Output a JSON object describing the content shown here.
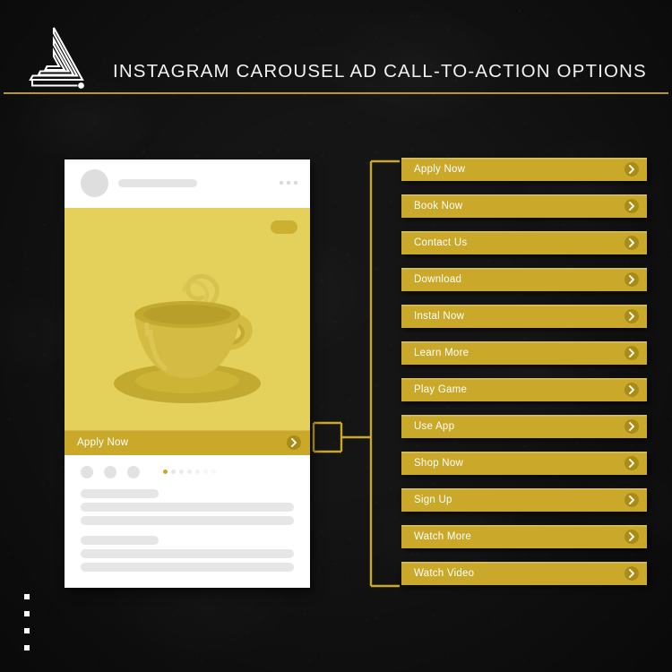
{
  "header": {
    "title": "INSTAGRAM CAROUSEL AD CALL-TO-ACTION OPTIONS",
    "logo_icon": "nested-triangle-logo-icon",
    "divider_color": "#b9991f"
  },
  "colors": {
    "gold": "#c9a82a",
    "gold_dark": "#a98c18",
    "gold_line": "#c9a82a",
    "post_yellow": "#e3d15c",
    "background": "#151515",
    "card_white": "#ffffff",
    "placeholder_gray": "#e6e6e6"
  },
  "mockup": {
    "name": "instagram-post-card",
    "header": {
      "avatar_icon": "avatar-placeholder-icon",
      "username_placeholder": "",
      "more_options_icon": "more-options-icon"
    },
    "image": {
      "subject": "coffee-cup-illustration",
      "sponsored_badge": "sponsored-badge"
    },
    "cta": {
      "label": "Apply Now",
      "arrow_icon": "chevron-right-icon"
    },
    "footer": {
      "actions": [
        "like-icon",
        "comment-icon",
        "share-icon"
      ],
      "pagination": {
        "total": 7,
        "active_index": 0
      },
      "caption_lines": 6
    }
  },
  "options": {
    "title": "Call-to-action options",
    "arrow_icon": "chevron-right-icon",
    "items": [
      {
        "label": "Apply Now"
      },
      {
        "label": "Book Now"
      },
      {
        "label": "Contact Us"
      },
      {
        "label": "Download"
      },
      {
        "label": "Instal Now"
      },
      {
        "label": "Learn More"
      },
      {
        "label": "Play Game"
      },
      {
        "label": "Use App"
      },
      {
        "label": "Shop Now"
      },
      {
        "label": "Sign Up"
      },
      {
        "label": "Watch More"
      },
      {
        "label": "Watch Video"
      }
    ]
  },
  "decoration": {
    "square_dots_count": 4
  }
}
